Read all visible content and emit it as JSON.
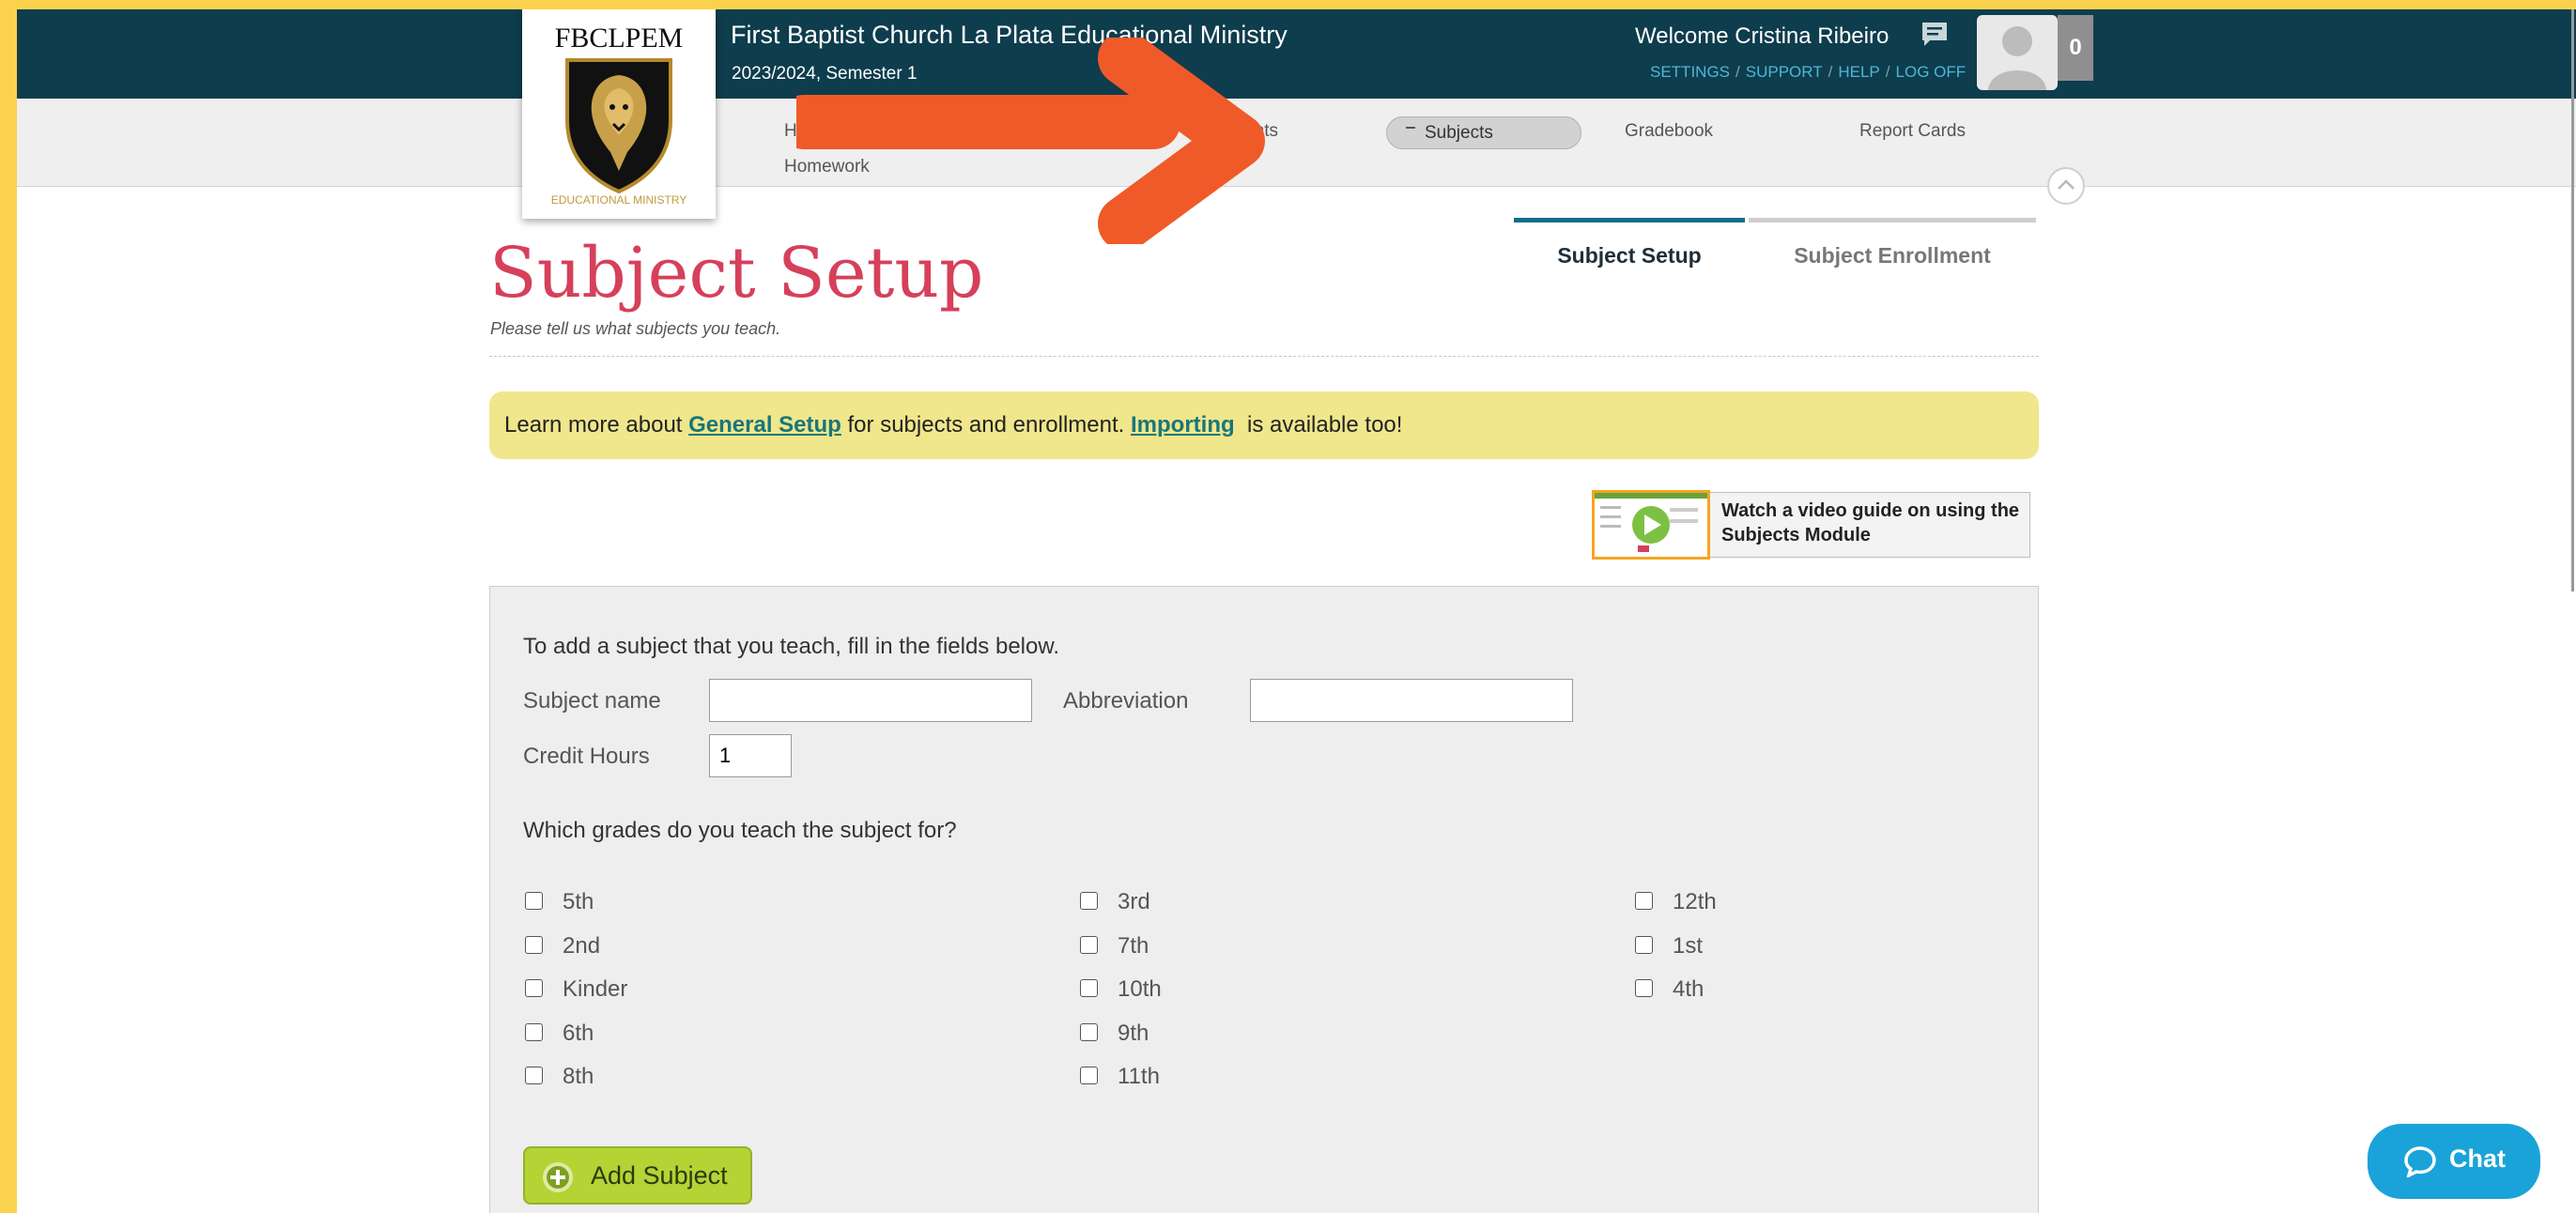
{
  "header": {
    "school_name": "First Baptist Church La Plata Educational Ministry",
    "term": "2023/2024, Semester 1",
    "welcome": "Welcome Cristina Ribeiro",
    "links": [
      "SETTINGS",
      "SUPPORT",
      "HELP",
      "LOG OFF"
    ],
    "notification_count": "0"
  },
  "logo": {
    "title": "FBCLPEM",
    "subtitle": "EDUCATIONAL MINISTRY"
  },
  "nav": {
    "items": [
      "Home",
      "Students",
      "Subjects",
      "Gradebook",
      "Report Cards",
      "Homework"
    ],
    "visible_labels": {
      "home_partial": "H",
      "students_partial": "udents",
      "subjects": "Subjects",
      "gradebook": "Gradebook",
      "report_cards": "Report Cards",
      "homework": "Homework"
    },
    "active": "Subjects"
  },
  "page": {
    "title": "Subject Setup",
    "subtitle": "Please tell us what subjects you teach."
  },
  "tabs": [
    {
      "label": "Subject Setup",
      "active": true
    },
    {
      "label": "Subject Enrollment",
      "active": false
    }
  ],
  "banner": {
    "text1": "Learn more about ",
    "link1": "General Setup",
    "text2": " for subjects and enrollment. ",
    "link2": "Importing",
    "text3": "  is available too!"
  },
  "video": {
    "line1": "Watch a video guide on using the",
    "line2": "Subjects Module"
  },
  "form": {
    "intro": "To add a subject that you teach, fill in the fields below.",
    "subject_name_label": "Subject name",
    "subject_name_value": "",
    "abbreviation_label": "Abbreviation",
    "abbreviation_value": "",
    "credit_hours_label": "Credit Hours",
    "credit_hours_value": "1",
    "grades_question": "Which grades do you teach the subject for?",
    "grades": [
      [
        "5th",
        "2nd",
        "Kinder",
        "6th",
        "8th"
      ],
      [
        "3rd",
        "7th",
        "10th",
        "9th",
        "11th"
      ],
      [
        "12th",
        "1st",
        "4th"
      ]
    ],
    "add_button": "Add Subject"
  },
  "chat": {
    "label": "Chat"
  },
  "colors": {
    "topbar": "#0e3d4d",
    "title": "#d6405a",
    "banner": "#f0e68c",
    "add_button": "#b5d334",
    "chat": "#1aa3d9",
    "arrow": "#f05a28",
    "background": "#fbd24e"
  }
}
